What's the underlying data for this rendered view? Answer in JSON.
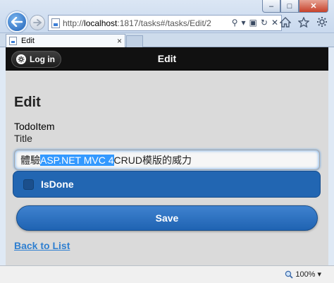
{
  "browser": {
    "window_buttons": {
      "minimize": "–",
      "maximize": "□",
      "close": "✕"
    },
    "address": {
      "prefix": "http://",
      "host": "localhost",
      "rest": ":1817/tasks#/tasks/Edit/2"
    },
    "tab": {
      "title": "Edit",
      "close": "×"
    },
    "toolbar_icons": [
      "home-icon",
      "star-icon",
      "gear-icon"
    ],
    "zoom": "100%",
    "zoom_arrow": "▾"
  },
  "header": {
    "login_label": "Log in",
    "title": "Edit"
  },
  "form": {
    "page_title": "Edit",
    "entity_name": "TodoItem",
    "title_label": "Title",
    "title_value": {
      "before": "體驗",
      "selected": "ASP.NET MVC 4",
      "after": " CRUD模版的威力"
    },
    "isdone_label": "IsDone",
    "isdone_checked": false,
    "save_label": "Save",
    "back_link": "Back to List"
  },
  "colors": {
    "header_bg": "#111111",
    "button_blue": "#2266b2",
    "link": "#2f7fd0",
    "selection": "#3399ff"
  }
}
